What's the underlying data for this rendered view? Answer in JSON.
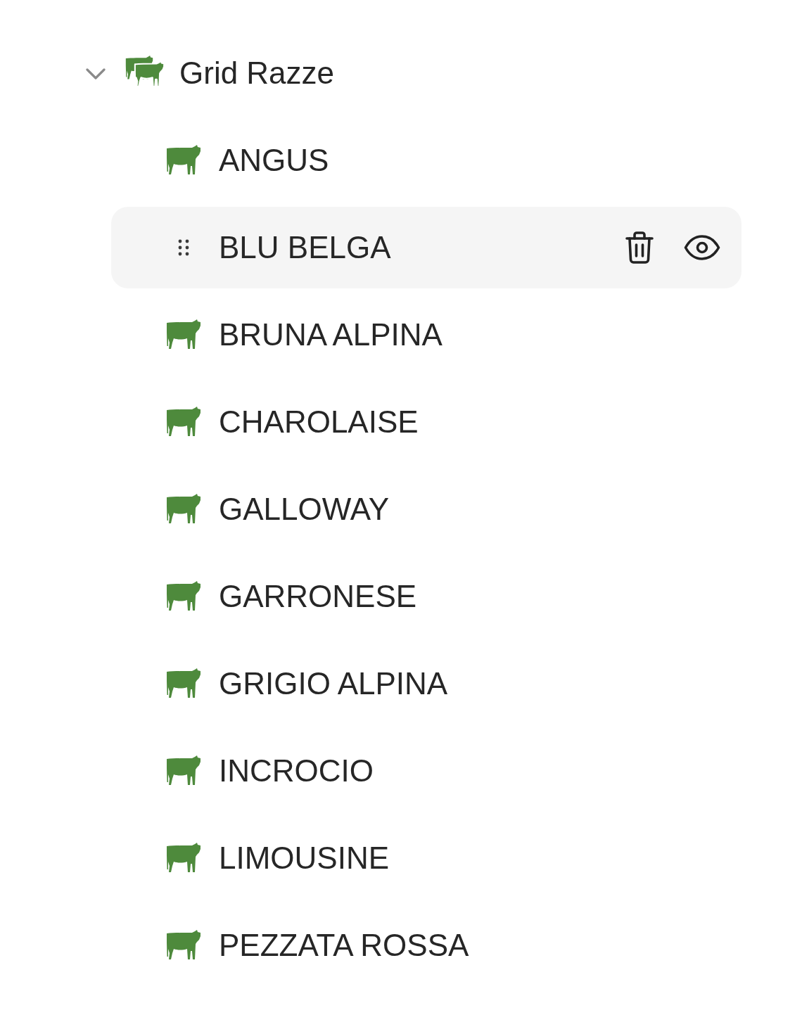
{
  "tree": {
    "label": "Grid Razze",
    "expanded": true,
    "children": [
      {
        "label": "ANGUS",
        "hovered": false
      },
      {
        "label": "BLU BELGA",
        "hovered": true
      },
      {
        "label": "BRUNA ALPINA",
        "hovered": false
      },
      {
        "label": "CHAROLAISE",
        "hovered": false
      },
      {
        "label": "GALLOWAY",
        "hovered": false
      },
      {
        "label": "GARRONESE",
        "hovered": false
      },
      {
        "label": "GRIGIO ALPINA",
        "hovered": false
      },
      {
        "label": "INCROCIO",
        "hovered": false
      },
      {
        "label": "LIMOUSINE",
        "hovered": false
      },
      {
        "label": "PEZZATA ROSSA",
        "hovered": false
      }
    ]
  }
}
